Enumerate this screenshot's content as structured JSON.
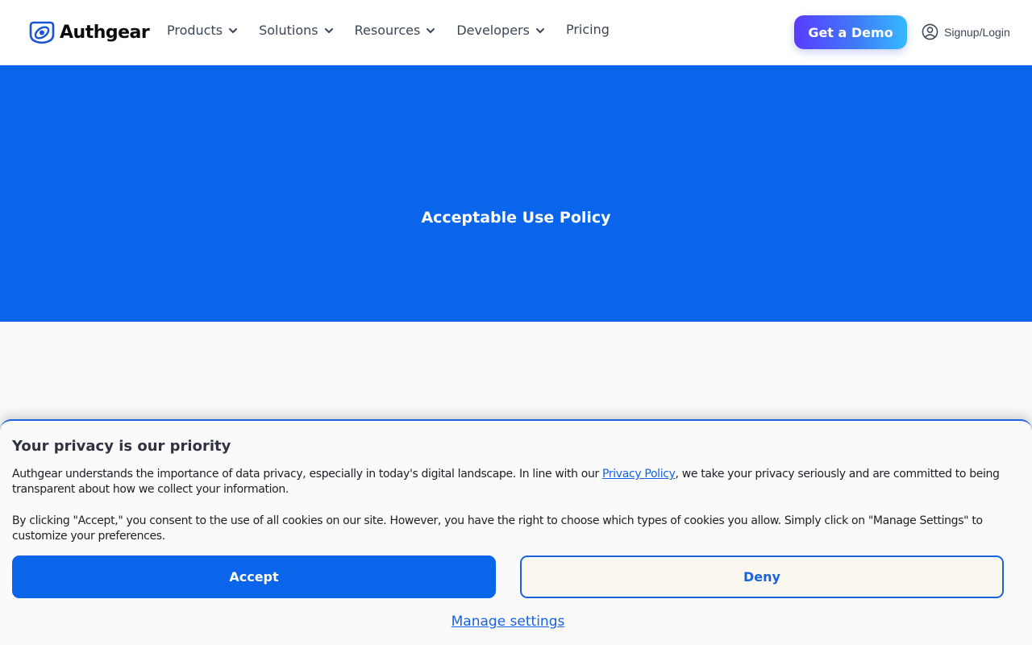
{
  "header": {
    "logo_text": "Authgear",
    "nav": [
      {
        "label": "Products"
      },
      {
        "label": "Solutions"
      },
      {
        "label": "Resources"
      },
      {
        "label": "Developers"
      },
      {
        "label": "Pricing"
      }
    ],
    "demo_button": "Get a Demo",
    "login_label": "Signup/Login"
  },
  "hero": {
    "title": "Acceptable Use Policy"
  },
  "cookie_banner": {
    "title": "Your privacy is our priority",
    "p1_before": "Authgear understands the importance of data privacy, especially in today's digital landscape. In line with our ",
    "p1_link": "Privacy Policy",
    "p1_after": ", we take your privacy seriously and are committed to being transparent about how we collect your information.",
    "p2": "By clicking \"Accept,\" you consent to the use of all cookies on our site. However, you have the right to choose which types of cookies you allow. Simply click on \"Manage Settings\" to customize your preferences.",
    "accept": "Accept",
    "deny": "Deny",
    "manage": "Manage settings"
  },
  "colors": {
    "brand_blue": "#0b65ea",
    "link_blue": "#1a63e0",
    "nav_text": "#3b4656"
  },
  "icons": [
    "authgear-logo-icon",
    "chevron-down-icon",
    "user-circle-icon"
  ]
}
